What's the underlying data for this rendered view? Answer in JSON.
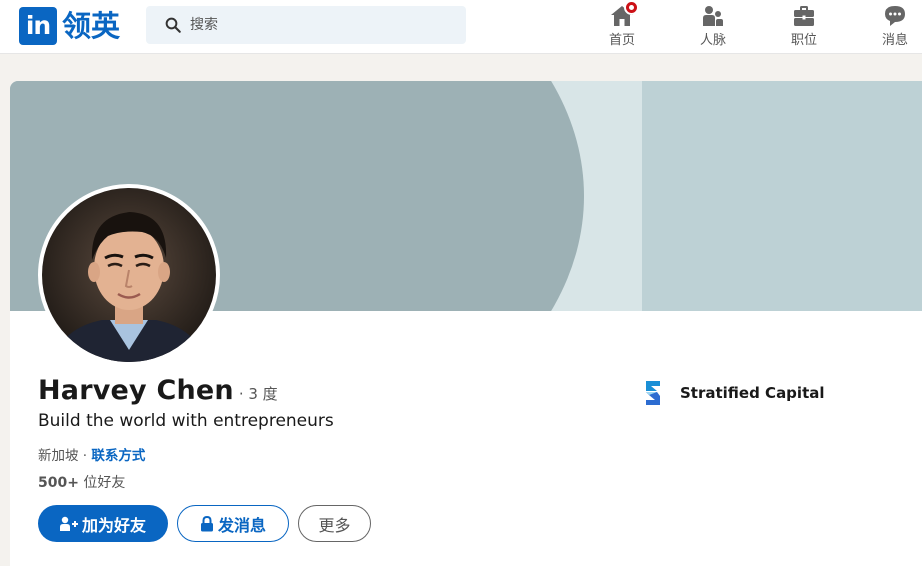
{
  "header": {
    "logo_mark": "in",
    "logo_text": "领英",
    "search_placeholder": "搜索",
    "nav": [
      {
        "label": "首页",
        "icon": "home-icon",
        "has_badge": true
      },
      {
        "label": "人脉",
        "icon": "people-icon"
      },
      {
        "label": "职位",
        "icon": "briefcase-icon"
      },
      {
        "label": "消息",
        "icon": "message-icon"
      }
    ]
  },
  "profile": {
    "name": "Harvey Chen",
    "degree": "· 3 度",
    "headline": "Build the world with entrepreneurs",
    "location": "新加坡",
    "separator": " · ",
    "contact_label": "联系方式",
    "connections_count": "500+",
    "connections_label": " 位好友",
    "company": "Stratified Capital"
  },
  "actions": {
    "connect": "加为好友",
    "message": "发消息",
    "more": "更多"
  },
  "colors": {
    "brand": "#0a66c2",
    "banner_dark": "#9db1b5",
    "banner_light": "#bdd1d5",
    "badge": "#cc1016"
  }
}
